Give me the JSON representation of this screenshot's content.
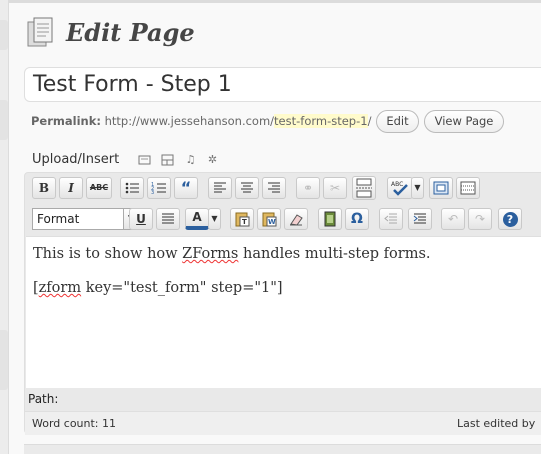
{
  "header": {
    "title": "Edit Page"
  },
  "post": {
    "title_value": "Test Form - Step 1"
  },
  "permalink": {
    "label": "Permalink:",
    "base_url": "http://www.jessehanson.com/",
    "slug": "test-form-step-1",
    "trailing": "/",
    "edit_label": "Edit",
    "view_label": "View Page"
  },
  "media": {
    "label": "Upload/Insert"
  },
  "toolbar": {
    "bold": "B",
    "italic": "I",
    "strike": "ABC",
    "quote": "“",
    "format_value": "Format",
    "underline": "U",
    "textcolor": "A",
    "omega": "Ω",
    "help": "?"
  },
  "content": {
    "paragraphs": [
      "This is to show how ZForms handles multi-step forms.",
      "[zform key=\"test_form\" step=\"1\"]"
    ],
    "p1_before": "This is to show how ",
    "p1_word": "ZForms",
    "p1_after": " handles multi-step forms.",
    "p2_before": "[",
    "p2_word": "zform",
    "p2_after": " key=\"test_form\" step=\"1\"]"
  },
  "status": {
    "path_label": "Path:",
    "word_count": "Word count: 11",
    "last_edited": "Last edited by"
  },
  "colors": {
    "accent": "#2b5f9e",
    "slug_highlight": "#fffbcc",
    "background": "#f9f9f9"
  }
}
